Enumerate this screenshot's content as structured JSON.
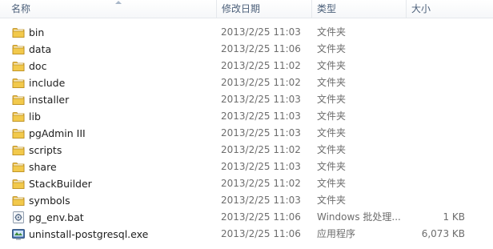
{
  "columns": {
    "name": "名称",
    "date": "修改日期",
    "type": "类型",
    "size": "大小"
  },
  "colors": {
    "folder": "#e8b83c",
    "header_text": "#4c607a",
    "meta_text": "#6d6d6d"
  },
  "files": [
    {
      "name": "bin",
      "date": "2013/2/25 11:03",
      "type": "文件夹",
      "size": "",
      "icon": "folder-icon"
    },
    {
      "name": "data",
      "date": "2013/2/25 11:06",
      "type": "文件夹",
      "size": "",
      "icon": "folder-icon"
    },
    {
      "name": "doc",
      "date": "2013/2/25 11:02",
      "type": "文件夹",
      "size": "",
      "icon": "folder-icon"
    },
    {
      "name": "include",
      "date": "2013/2/25 11:02",
      "type": "文件夹",
      "size": "",
      "icon": "folder-icon"
    },
    {
      "name": "installer",
      "date": "2013/2/25 11:03",
      "type": "文件夹",
      "size": "",
      "icon": "folder-icon"
    },
    {
      "name": "lib",
      "date": "2013/2/25 11:03",
      "type": "文件夹",
      "size": "",
      "icon": "folder-icon"
    },
    {
      "name": "pgAdmin III",
      "date": "2013/2/25 11:03",
      "type": "文件夹",
      "size": "",
      "icon": "folder-icon"
    },
    {
      "name": "scripts",
      "date": "2013/2/25 11:02",
      "type": "文件夹",
      "size": "",
      "icon": "folder-icon"
    },
    {
      "name": "share",
      "date": "2013/2/25 11:03",
      "type": "文件夹",
      "size": "",
      "icon": "folder-icon"
    },
    {
      "name": "StackBuilder",
      "date": "2013/2/25 11:02",
      "type": "文件夹",
      "size": "",
      "icon": "folder-icon"
    },
    {
      "name": "symbols",
      "date": "2013/2/25 11:03",
      "type": "文件夹",
      "size": "",
      "icon": "folder-icon"
    },
    {
      "name": "pg_env.bat",
      "date": "2013/2/25 11:06",
      "type": "Windows 批处理...",
      "size": "1 KB",
      "icon": "batch-file-icon"
    },
    {
      "name": "uninstall-postgresql.exe",
      "date": "2013/2/25 11:06",
      "type": "应用程序",
      "size": "6,073 KB",
      "icon": "uninstaller-exe-icon"
    }
  ]
}
